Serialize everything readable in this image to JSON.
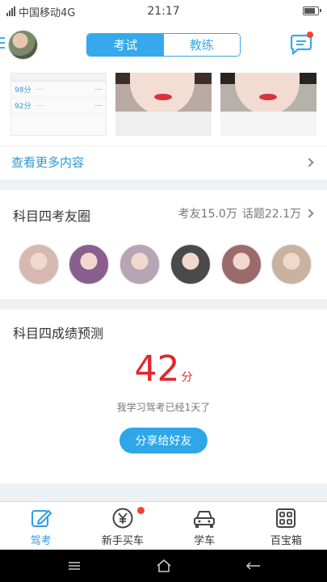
{
  "status_bar": {
    "carrier": "中国移动4G",
    "time": "21:17"
  },
  "header": {
    "tabs": [
      {
        "label": "考试",
        "active": true
      },
      {
        "label": "教练",
        "active": false
      }
    ]
  },
  "top_card": {
    "scores": [
      {
        "value": "98分"
      },
      {
        "value": "92分"
      }
    ],
    "more_link": "查看更多内容"
  },
  "circle": {
    "title": "科目四考友圈",
    "members_count": "考友15.0万",
    "topics_count": "话题22.1万",
    "member_colors": [
      "#d7b7b2",
      "#8a5f8f",
      "#b7a5b6",
      "#4a4a4a",
      "#9b6b6b",
      "#cab2a0"
    ]
  },
  "predict": {
    "title": "科目四成绩预测",
    "score": "42",
    "unit": "分",
    "days_text": "我学习驾考已经1天了",
    "share_button": "分享给好友"
  },
  "tabbar": {
    "items": [
      {
        "label": "驾考",
        "icon": "edit-icon",
        "active": true
      },
      {
        "label": "新手买车",
        "icon": "yen-icon",
        "active": false
      },
      {
        "label": "学车",
        "icon": "car-icon",
        "active": false
      },
      {
        "label": "百宝箱",
        "icon": "grid-icon",
        "active": false
      }
    ]
  },
  "colors": {
    "accent": "#35a9ec",
    "score_red": "#e3262b",
    "badge_red": "#f0433a"
  }
}
